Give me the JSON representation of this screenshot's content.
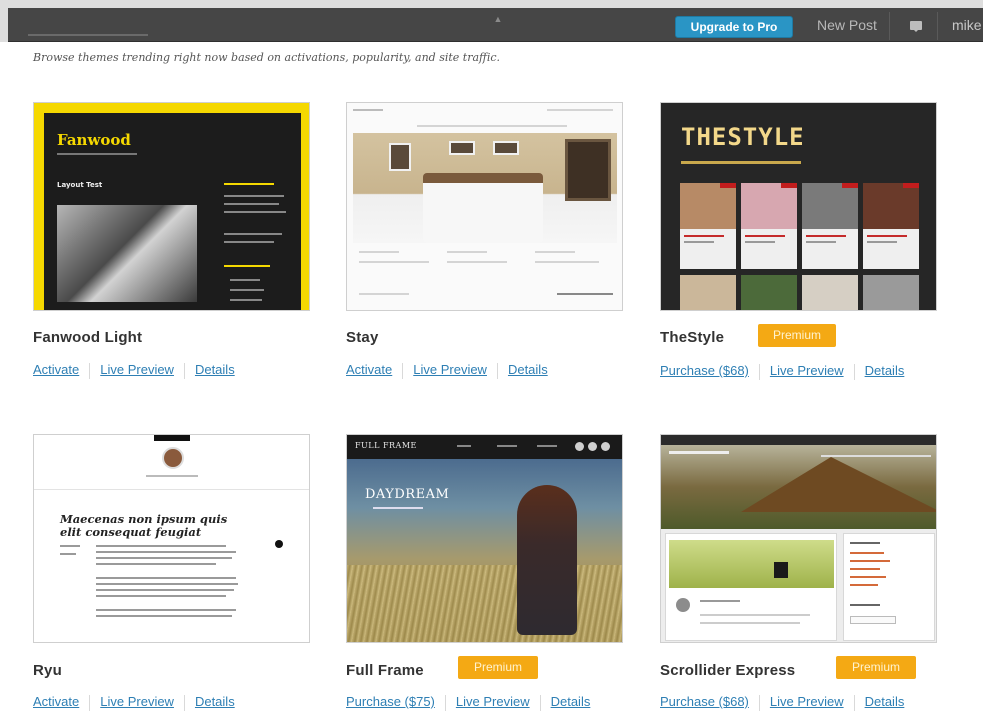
{
  "adminbar": {
    "upgrade_label": "Upgrade to Pro",
    "new_post_label": "New Post",
    "username": "mike"
  },
  "intro_text": "Browse themes trending right now based on activations, popularity, and site traffic.",
  "themes": [
    {
      "name": "Fanwood Light",
      "premium": false,
      "actions": [
        "Activate",
        "Live Preview",
        "Details"
      ],
      "preview": {
        "title": "Fanwood",
        "post_title": "Layout Test"
      }
    },
    {
      "name": "Stay",
      "premium": false,
      "actions": [
        "Activate",
        "Live Preview",
        "Details"
      ]
    },
    {
      "name": "TheStyle",
      "premium": true,
      "premium_label": "Premium",
      "actions": [
        "Purchase ($68)",
        "Live Preview",
        "Details"
      ],
      "preview": {
        "title": "THESTYLE"
      }
    },
    {
      "name": "Ryu",
      "premium": false,
      "actions": [
        "Activate",
        "Live Preview",
        "Details"
      ],
      "preview": {
        "post_title": "Maecenas non ipsum quis elit consequat feugiat"
      }
    },
    {
      "name": "Full Frame",
      "premium": true,
      "premium_label": "Premium",
      "actions": [
        "Purchase ($75)",
        "Live Preview",
        "Details"
      ],
      "preview": {
        "brand": "FULL FRAME",
        "headline": "DAYDREAM"
      }
    },
    {
      "name": "Scrollider Express",
      "premium": true,
      "premium_label": "Premium",
      "actions": [
        "Purchase ($68)",
        "Live Preview",
        "Details"
      ]
    }
  ],
  "colors": {
    "admin_bar": "#464646",
    "upgrade_button": "#2a95c5",
    "premium_badge": "#f4a914",
    "link": "#2e7fb4"
  },
  "icons": [
    "comment-bubble-icon"
  ]
}
